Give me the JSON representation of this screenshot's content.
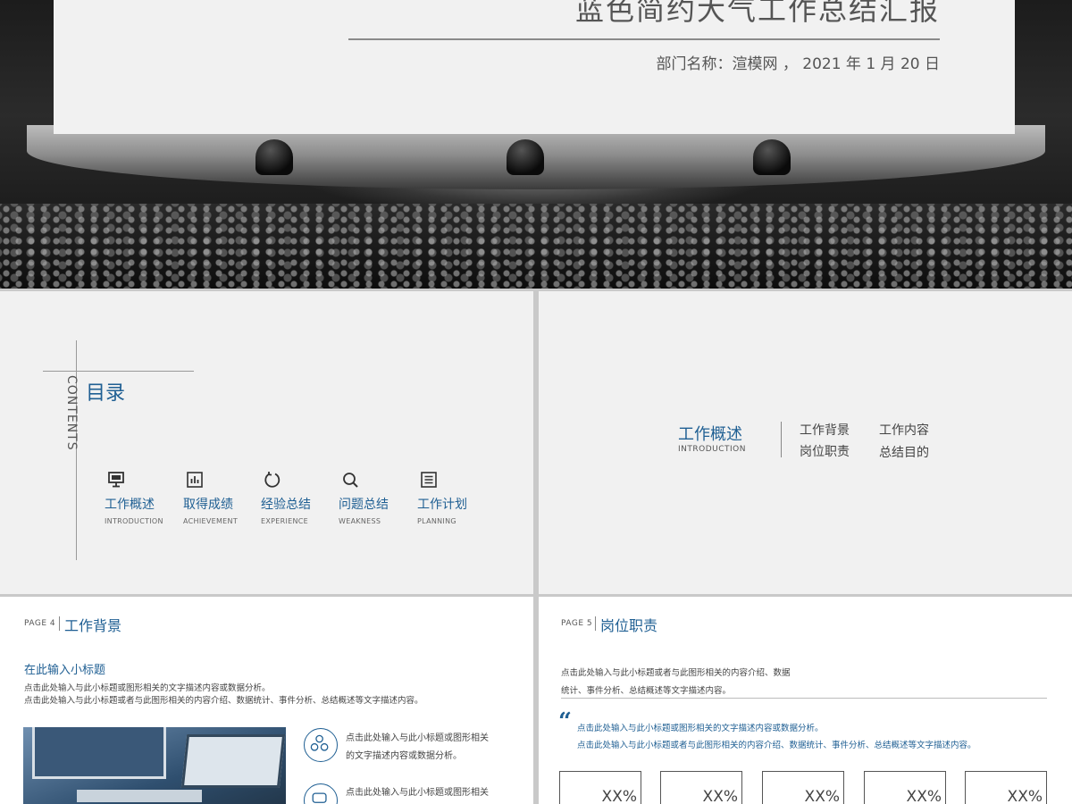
{
  "hero": {
    "title": "蓝色简约大气工作总结汇报",
    "department": "部门名称：渲模网 ， 2021 年 1 月 20 日"
  },
  "contents_slide": {
    "vertical_label": "CONTENTS",
    "title": "目录",
    "items": [
      {
        "icon": "monitor-icon",
        "zh": "工作概述",
        "en": "INTRODUCTION"
      },
      {
        "icon": "bar-chart-icon",
        "zh": "取得成绩",
        "en": "ACHIEVEMENT"
      },
      {
        "icon": "refresh-icon",
        "zh": "经验总结",
        "en": "EXPERIENCE"
      },
      {
        "icon": "search-icon",
        "zh": "问题总结",
        "en": "WEAKNESS"
      },
      {
        "icon": "list-icon",
        "zh": "工作计划",
        "en": "PLANNING"
      }
    ]
  },
  "section_slide": {
    "title": "工作概述",
    "subtitle": "INTRODUCTION",
    "subs": [
      "工作背景",
      "工作内容",
      "岗位职责",
      "总结目的"
    ]
  },
  "page4": {
    "page_tag": "PAGE 4",
    "title": "工作背景",
    "subheading": "在此输入小标题",
    "line1": "点击此处输入与此小标题或图形相关的文字描述内容或数据分析。",
    "line2": "点击此处输入与此小标题或者与此图形相关的内容介绍、数据统计、事件分析、总结概述等文字描述内容。",
    "bullets": [
      {
        "icon": "network-icon",
        "line1": "点击此处输入与此小标题或图形相关",
        "line2": "的文字描述内容或数据分析。"
      },
      {
        "icon": "chat-icon",
        "line1": "点击此处输入与此小标题或图形相关",
        "line2": ""
      }
    ]
  },
  "page5": {
    "page_tag": "PAGE 5",
    "title": "岗位职责",
    "line1": "点击此处输入与此小标题或者与此图形相关的内容介绍、数据",
    "line2": "统计、事件分析、总结概述等文字描述内容。",
    "quote_mark": "“",
    "quote1": "点击此处输入与此小标题或图形相关的文字描述内容或数据分析。",
    "quote2": "点击此处输入与此小标题或者与此图形相关的内容介绍、数据统计、事件分析、总结概述等文字描述内容。",
    "boxes": [
      "XX%",
      "XX%",
      "XX%",
      "XX%",
      "XX%"
    ]
  },
  "colors": {
    "accent": "#1f5f93",
    "panel": "#f1f1f1"
  }
}
